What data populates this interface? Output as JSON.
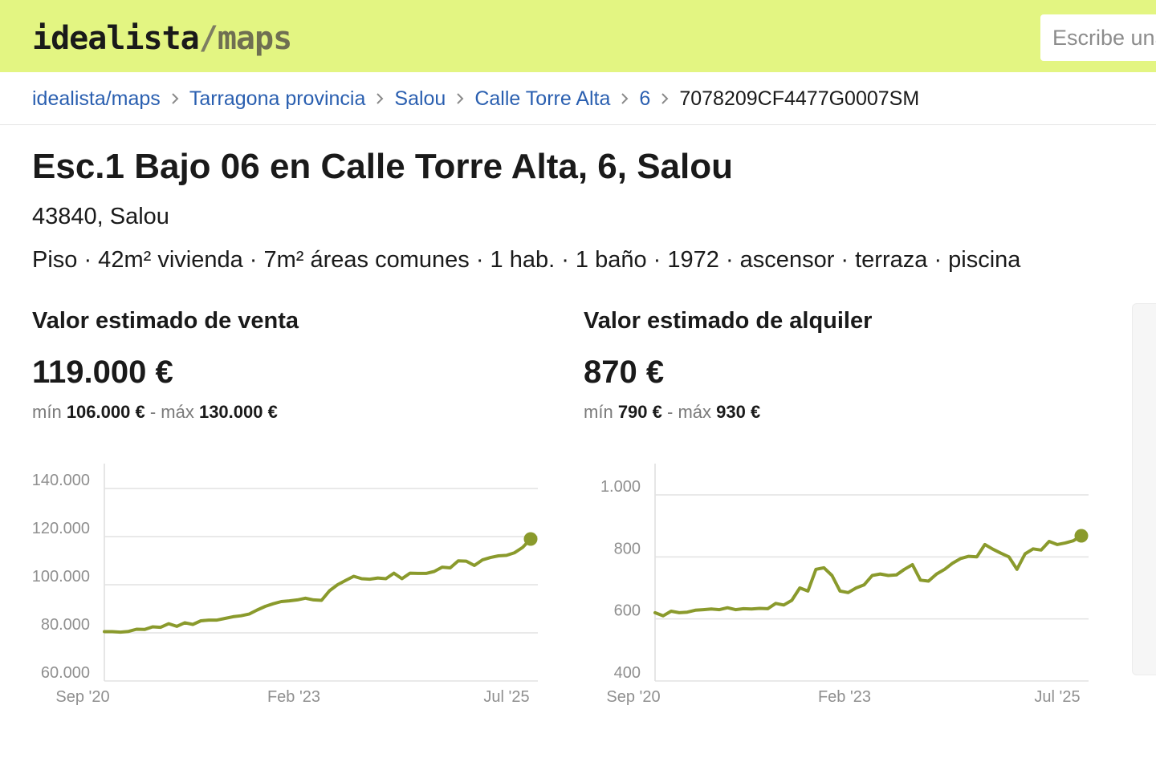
{
  "header": {
    "logo": {
      "brand": "idealista",
      "slash": "/",
      "product": "maps"
    },
    "search": {
      "placeholder": "Escribe una dirección",
      "value": ""
    }
  },
  "breadcrumb": {
    "items": [
      "idealista/maps",
      "Tarragona provincia",
      "Salou",
      "Calle Torre Alta",
      "6"
    ],
    "current": "7078209CF4477G0007SM"
  },
  "property": {
    "title": "Esc.1 Bajo 06 en Calle Torre Alta, 6, Salou",
    "address": "43840, Salou",
    "features": "Piso · 42m² vivienda · 7m² áreas comunes · 1 hab. · 1 baño · 1972 · ascensor · terraza · piscina"
  },
  "sale": {
    "label": "Valor estimado de venta",
    "price": "119.000 €",
    "min_label": "mín",
    "min": "106.000 €",
    "dash": "-",
    "max_label": "máx",
    "max": "130.000 €"
  },
  "rent": {
    "label": "Valor estimado de alquiler",
    "price": "870 €",
    "min_label": "mín",
    "min": "790 €",
    "dash": "-",
    "max_label": "máx",
    "max": "930 €"
  },
  "colors": {
    "header_bg": "#e3f582",
    "link": "#2a5fb0",
    "line": "#8a9a2c"
  },
  "chart_data": [
    {
      "type": "line",
      "title": "",
      "xlabel": "",
      "ylabel": "",
      "grid": true,
      "x_ticks": [
        "Sep '20",
        "Feb '23",
        "Jul '25"
      ],
      "y_ticks": [
        "140.000",
        "120.000",
        "100.000",
        "80.000",
        "60.000"
      ],
      "ylim": [
        60000,
        140000
      ],
      "x": [
        "2020-09",
        "2020-10",
        "2020-11",
        "2020-12",
        "2021-01",
        "2021-02",
        "2021-03",
        "2021-04",
        "2021-05",
        "2021-06",
        "2021-07",
        "2021-08",
        "2021-09",
        "2021-10",
        "2021-11",
        "2021-12",
        "2022-01",
        "2022-02",
        "2022-03",
        "2022-04",
        "2022-05",
        "2022-06",
        "2022-07",
        "2022-08",
        "2022-09",
        "2022-10",
        "2022-11",
        "2022-12",
        "2023-01",
        "2023-02",
        "2023-03",
        "2023-04",
        "2023-05",
        "2023-06",
        "2023-07",
        "2023-08",
        "2023-09",
        "2023-10",
        "2023-11",
        "2023-12",
        "2024-01",
        "2024-02",
        "2024-03",
        "2024-04",
        "2024-05",
        "2024-06",
        "2024-07",
        "2024-08",
        "2024-09",
        "2024-10",
        "2024-11",
        "2024-12",
        "2025-01",
        "2025-02",
        "2025-03",
        "2025-04",
        "2025-05",
        "2025-06",
        "2025-07"
      ],
      "values": [
        80500,
        80500,
        80300,
        80600,
        81500,
        81400,
        82500,
        82300,
        83800,
        82700,
        84200,
        83500,
        85000,
        85300,
        85300,
        86000,
        86700,
        87100,
        87800,
        89500,
        91000,
        92100,
        93000,
        93300,
        93700,
        94400,
        93700,
        93500,
        97500,
        100000,
        101800,
        103500,
        102500,
        102300,
        102800,
        102500,
        104800,
        102500,
        104800,
        104700,
        104700,
        105500,
        107300,
        107000,
        109900,
        109800,
        108000,
        110300,
        111300,
        112000,
        112200,
        113300,
        115500,
        119000
      ],
      "series": [
        {
          "values": []
        }
      ]
    },
    {
      "type": "line",
      "title": "",
      "xlabel": "",
      "ylabel": "",
      "grid": true,
      "x_ticks": [
        "Sep '20",
        "Feb '23",
        "Jul '25"
      ],
      "y_ticks": [
        "1.000",
        "800",
        "600",
        "400"
      ],
      "ylim": [
        400,
        1000
      ],
      "values": [
        620,
        610,
        625,
        620,
        622,
        628,
        630,
        632,
        630,
        636,
        630,
        633,
        632,
        634,
        633,
        650,
        645,
        660,
        700,
        690,
        760,
        765,
        740,
        690,
        685,
        700,
        710,
        740,
        745,
        740,
        742,
        760,
        775,
        725,
        722,
        745,
        760,
        780,
        795,
        802,
        800,
        840,
        825,
        812,
        800,
        760,
        810,
        826,
        822,
        850,
        840,
        845,
        852,
        868
      ]
    }
  ]
}
